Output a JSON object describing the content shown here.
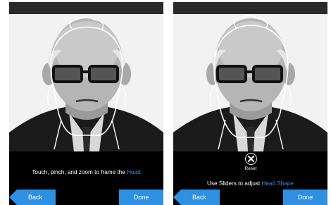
{
  "screens": [
    {
      "instruction_prefix": "Touch, pinch, and zoom to frame the ",
      "instruction_highlight": "Head",
      "back_label": "Back",
      "done_label": "Done"
    },
    {
      "reset_label": "Reset",
      "instruction_prefix": "Use Sliders to adjust  ",
      "instruction_highlight": "Head Shape",
      "back_label": "Back",
      "done_label": "Done"
    }
  ],
  "colors": {
    "accent": "#2f8fe0",
    "highlight_text": "#3a8de0",
    "background": "#000000",
    "photo_background": "#f2f2f2"
  },
  "icons": {
    "reset": "reset-x-icon",
    "back": "back-arrow-shape"
  }
}
